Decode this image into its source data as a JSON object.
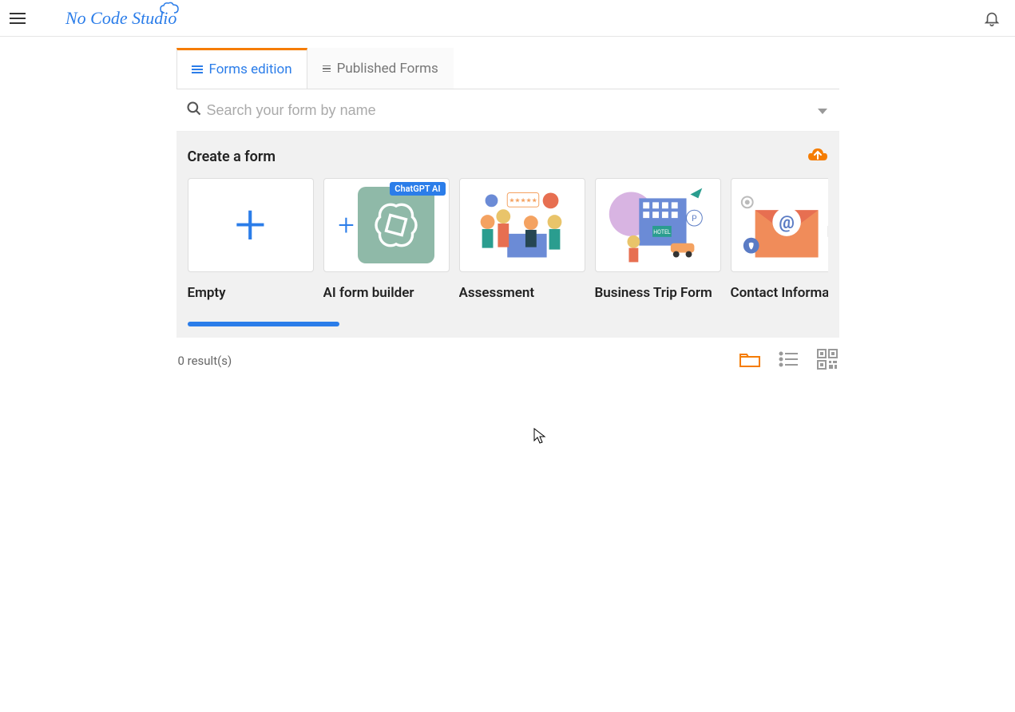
{
  "header": {
    "logo_text": "No Code Studio"
  },
  "tabs": [
    {
      "label": "Forms edition",
      "active": true
    },
    {
      "label": "Published Forms",
      "active": false
    }
  ],
  "search": {
    "placeholder": "Search your form by name"
  },
  "create": {
    "title": "Create a form",
    "templates": [
      {
        "label": "Empty",
        "kind": "empty"
      },
      {
        "label": "AI form builder",
        "kind": "ai",
        "badge": "ChatGPT AI"
      },
      {
        "label": "Assessment",
        "kind": "assessment"
      },
      {
        "label": "Business Trip Form",
        "kind": "business"
      },
      {
        "label": "Contact Information",
        "kind": "contact"
      }
    ]
  },
  "results": {
    "text": "0 result(s)"
  }
}
